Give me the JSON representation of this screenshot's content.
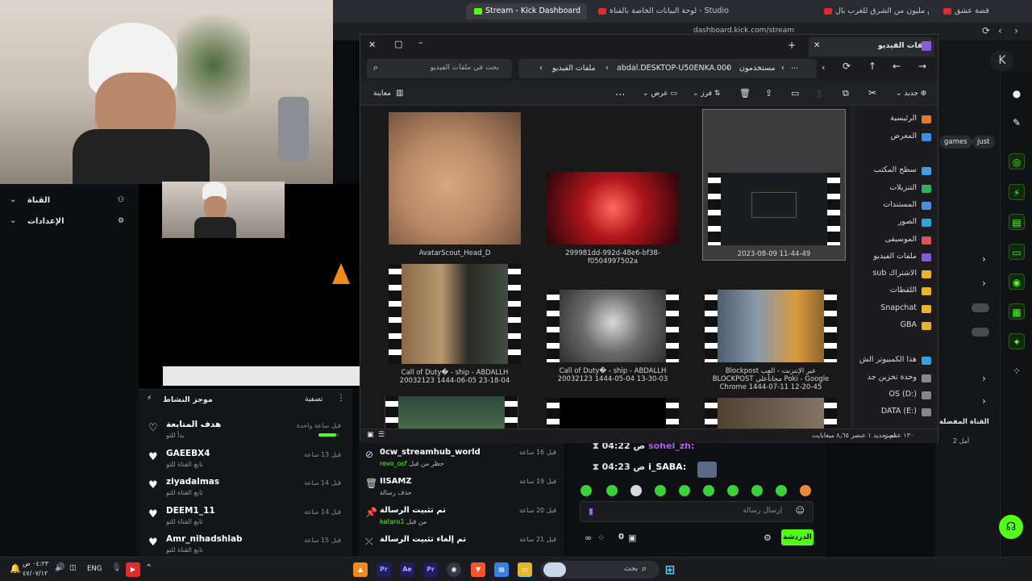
{
  "browser": {
    "tabs": [
      {
        "label": "قصة عشق",
        "active": false
      },
      {
        "label": "تحدي النص مليون من الشرق للغرب بال...",
        "active": false
      },
      {
        "label": "لوحة البيانات الخاصة بالقناة - Studio",
        "active": false
      },
      {
        "label": "Stream - Kick Dashboard",
        "active": true
      }
    ],
    "address": "dashboard.kick.com/stream"
  },
  "explorer": {
    "title": "ملفات الفيديو",
    "add_tab": "+",
    "breadcrumb": [
      "مستخدمون",
      "abdal.DESKTOP-U50ENKA.000",
      "ملفات الفيديو"
    ],
    "more_crumbs": "...",
    "search_placeholder": "بحث في ملفات الفيديو",
    "toolbar": {
      "new": "جديد",
      "sort": "فرز",
      "view": "عرض",
      "more": "...",
      "preview": "معاينة"
    },
    "files": [
      {
        "name": "2023-08-09 11-44-49",
        "kind": "video",
        "selected": true
      },
      {
        "name": "299981dd-992d-48e6-bf38-f0504997502a",
        "kind": "image"
      },
      {
        "name": "AvatarScout_Head_D",
        "kind": "image"
      },
      {
        "name": "Blockpost عبر الإنترنت - العب BLOCKPOST مجاناًعلى Poki - Google Chrome 1444-07-11 12-20-45",
        "kind": "video"
      },
      {
        "name": "Call of Duty� - ship - ABDALLH 20032123 1444-05-04 13-30-03",
        "kind": "video"
      },
      {
        "name": "Call of Duty� - ship - ABDALLH 20032123 1444-06-05 23-18-04",
        "kind": "video"
      }
    ],
    "nav": [
      {
        "label": "الرئيسية",
        "color": "#e07a2e"
      },
      {
        "label": "المعرض",
        "color": "#3a8ee6"
      },
      {
        "label": "سطح المكتب",
        "color": "#3aa0e6"
      },
      {
        "label": "التنزيلات",
        "color": "#2fb35a"
      },
      {
        "label": "المستندات",
        "color": "#4a8ce0"
      },
      {
        "label": "الصور",
        "color": "#2fa2d8"
      },
      {
        "label": "الموسيقى",
        "color": "#e0525a"
      },
      {
        "label": "ملفات الفيديو",
        "color": "#8a5ad8"
      },
      {
        "label": "الاشتراك sub",
        "color": "#e8b52a"
      },
      {
        "label": "اللقطات",
        "color": "#e8b52a"
      },
      {
        "label": "Snapchat",
        "color": "#e8b52a"
      },
      {
        "label": "GBA",
        "color": "#e8b52a"
      },
      {
        "label": "هذا الكمبيوتر الش",
        "color": "#3aa0e6"
      },
      {
        "label": "وحدة تخزين جد",
        "color": "#888888"
      },
      {
        "label": "OS (D:)",
        "color": "#888888"
      },
      {
        "label": "DATA (E:)",
        "color": "#888888"
      }
    ],
    "status": {
      "count": "١٣٠ عناصر",
      "selected": "تم تحديد ١ عنصر ٨٫٦٥ ميغابايت"
    }
  },
  "sidebar": {
    "items": [
      {
        "label": "القناة"
      },
      {
        "label": "الإعدادات"
      }
    ]
  },
  "activity": {
    "title": "موجز النشاط",
    "filter": "تصفية",
    "rows": [
      {
        "name": "هدف المتابعة",
        "sub": "بدأ للتو",
        "time": "قبل ساعة واحدة",
        "progress": 0.85
      },
      {
        "name": "GAEEBX4",
        "sub": "تابع القناة للتو",
        "time": "قبل 13 ساعة"
      },
      {
        "name": "ziyadalmas",
        "sub": "تابع القناة للتو",
        "time": "قبل 14 ساعة"
      },
      {
        "name": "DEEM1_11",
        "sub": "تابع القناة للتو",
        "time": "قبل 14 ساعة"
      },
      {
        "name": "Amr_nihadshlab",
        "sub": "تابع القناة للتو",
        "time": "قبل 15 ساعة"
      }
    ]
  },
  "modlog": {
    "rows": [
      {
        "name": "0cw_streamhub_world",
        "sub": "حظر من قبل",
        "user": "revo_osf",
        "time": "قبل 16 ساعة",
        "icon": "ban-icon"
      },
      {
        "name": "IISAMZ",
        "sub": "حذف رسالة",
        "user": "",
        "time": "قبل 19 ساعة",
        "icon": "trash-icon"
      },
      {
        "name": "تم تثبيت الرسالة",
        "sub": "من قبل",
        "user": "kataro1",
        "time": "قبل 20 ساعة",
        "icon": "pin-icon"
      },
      {
        "name": "تم إلغاء تثبيت الرسالة",
        "sub": "",
        "user": "",
        "time": "قبل 21 ساعة",
        "icon": "unpin-icon"
      }
    ]
  },
  "chat": {
    "messages": [
      {
        "user": "sohel_zh:",
        "time": "04:22 ص",
        "color": "#b75cf0"
      },
      {
        "user": "i_SABA:",
        "time": "04:23 ص",
        "color": "#ffffff"
      }
    ],
    "placeholder": "إرسال رسالة",
    "send": "الدردشة",
    "viewers": "0"
  },
  "kick": {
    "chips": [
      "just",
      "games"
    ],
    "section": "القناة المفضلة",
    "count": "أمل 2"
  },
  "taskbar": {
    "lang": "ENG",
    "time": "٠٤:٢٣ ص",
    "date": "٤٧/٠٧/١٢",
    "search": "بحث"
  }
}
